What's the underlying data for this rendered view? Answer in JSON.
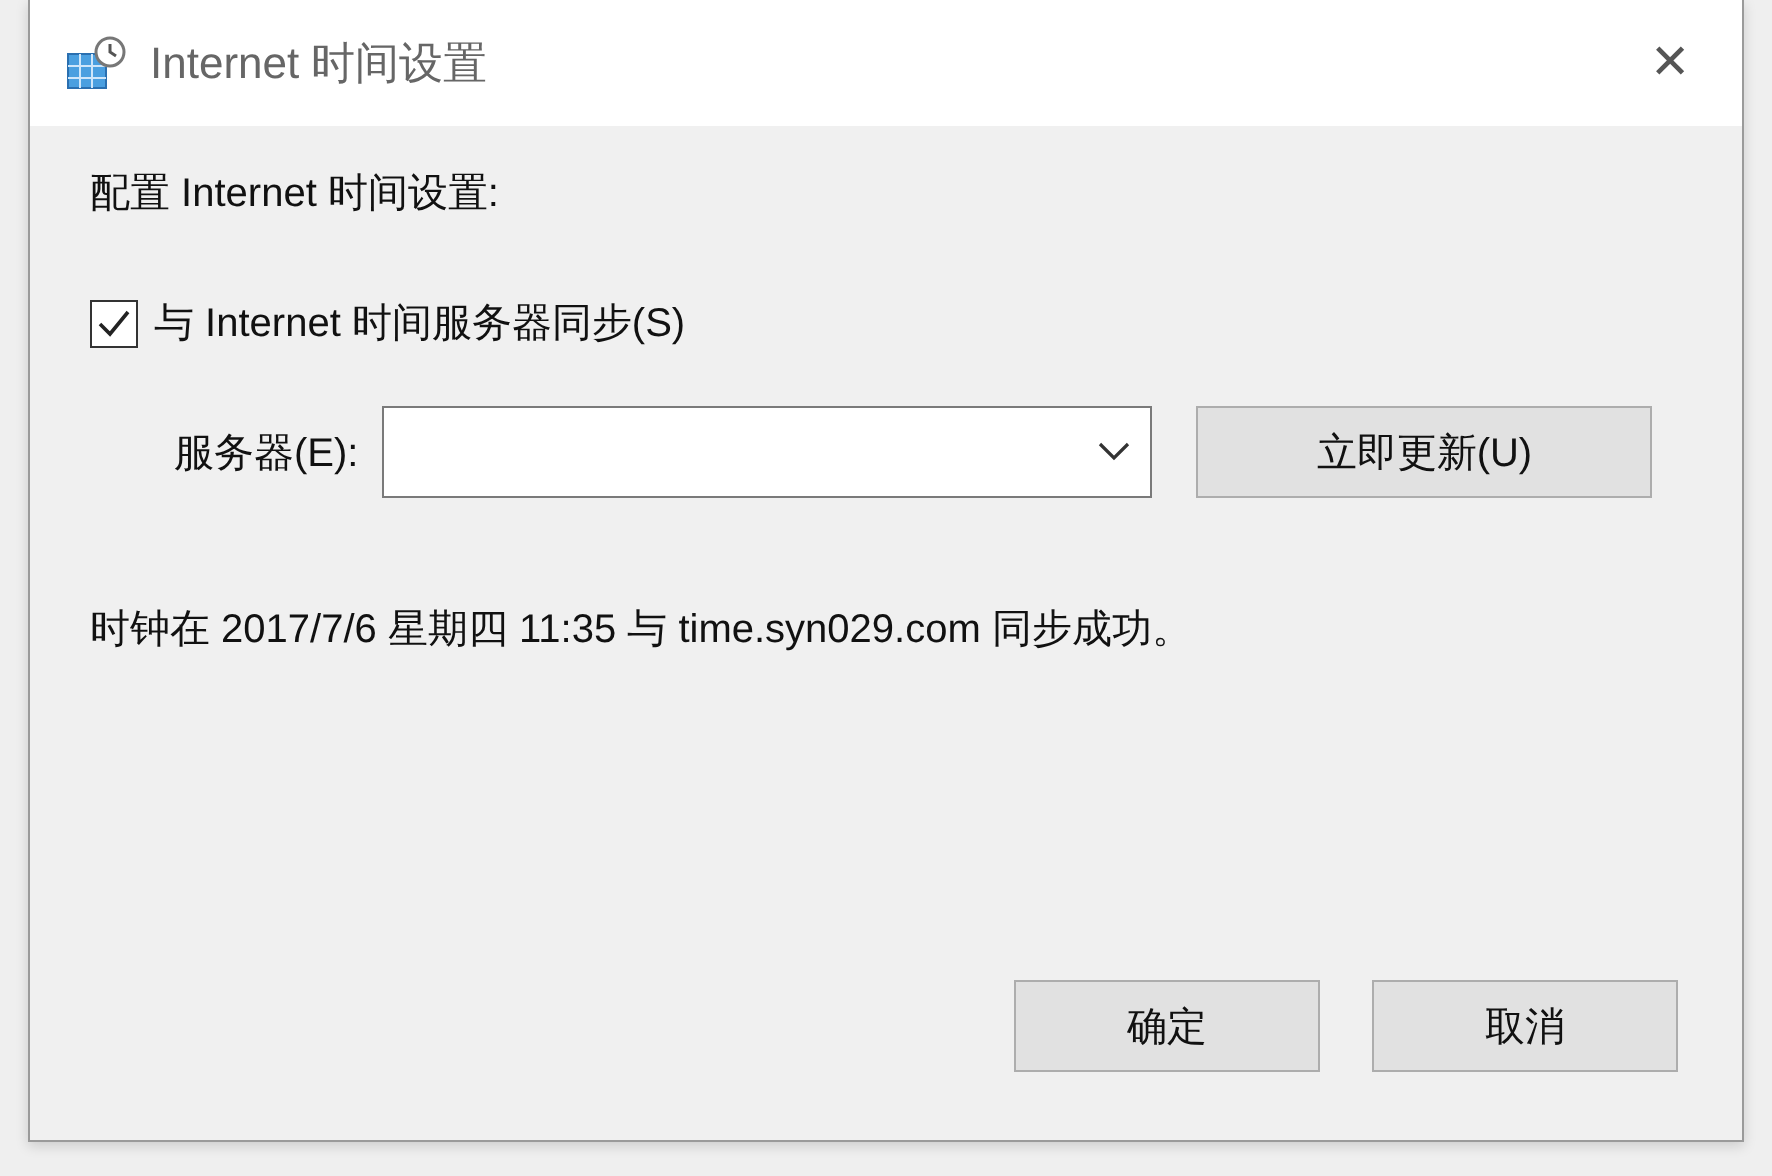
{
  "window": {
    "title": "Internet 时间设置",
    "close": "✕"
  },
  "heading": "配置 Internet 时间设置:",
  "sync_checkbox": {
    "label": "与 Internet 时间服务器同步(S)",
    "checked": true
  },
  "server": {
    "label": "服务器(E):",
    "update_button": "立即更新(U)"
  },
  "status": "时钟在 2017/7/6 星期四 11:35 与 time.syn029.com 同步成功。",
  "buttons": [
    "确定",
    "取消"
  ]
}
